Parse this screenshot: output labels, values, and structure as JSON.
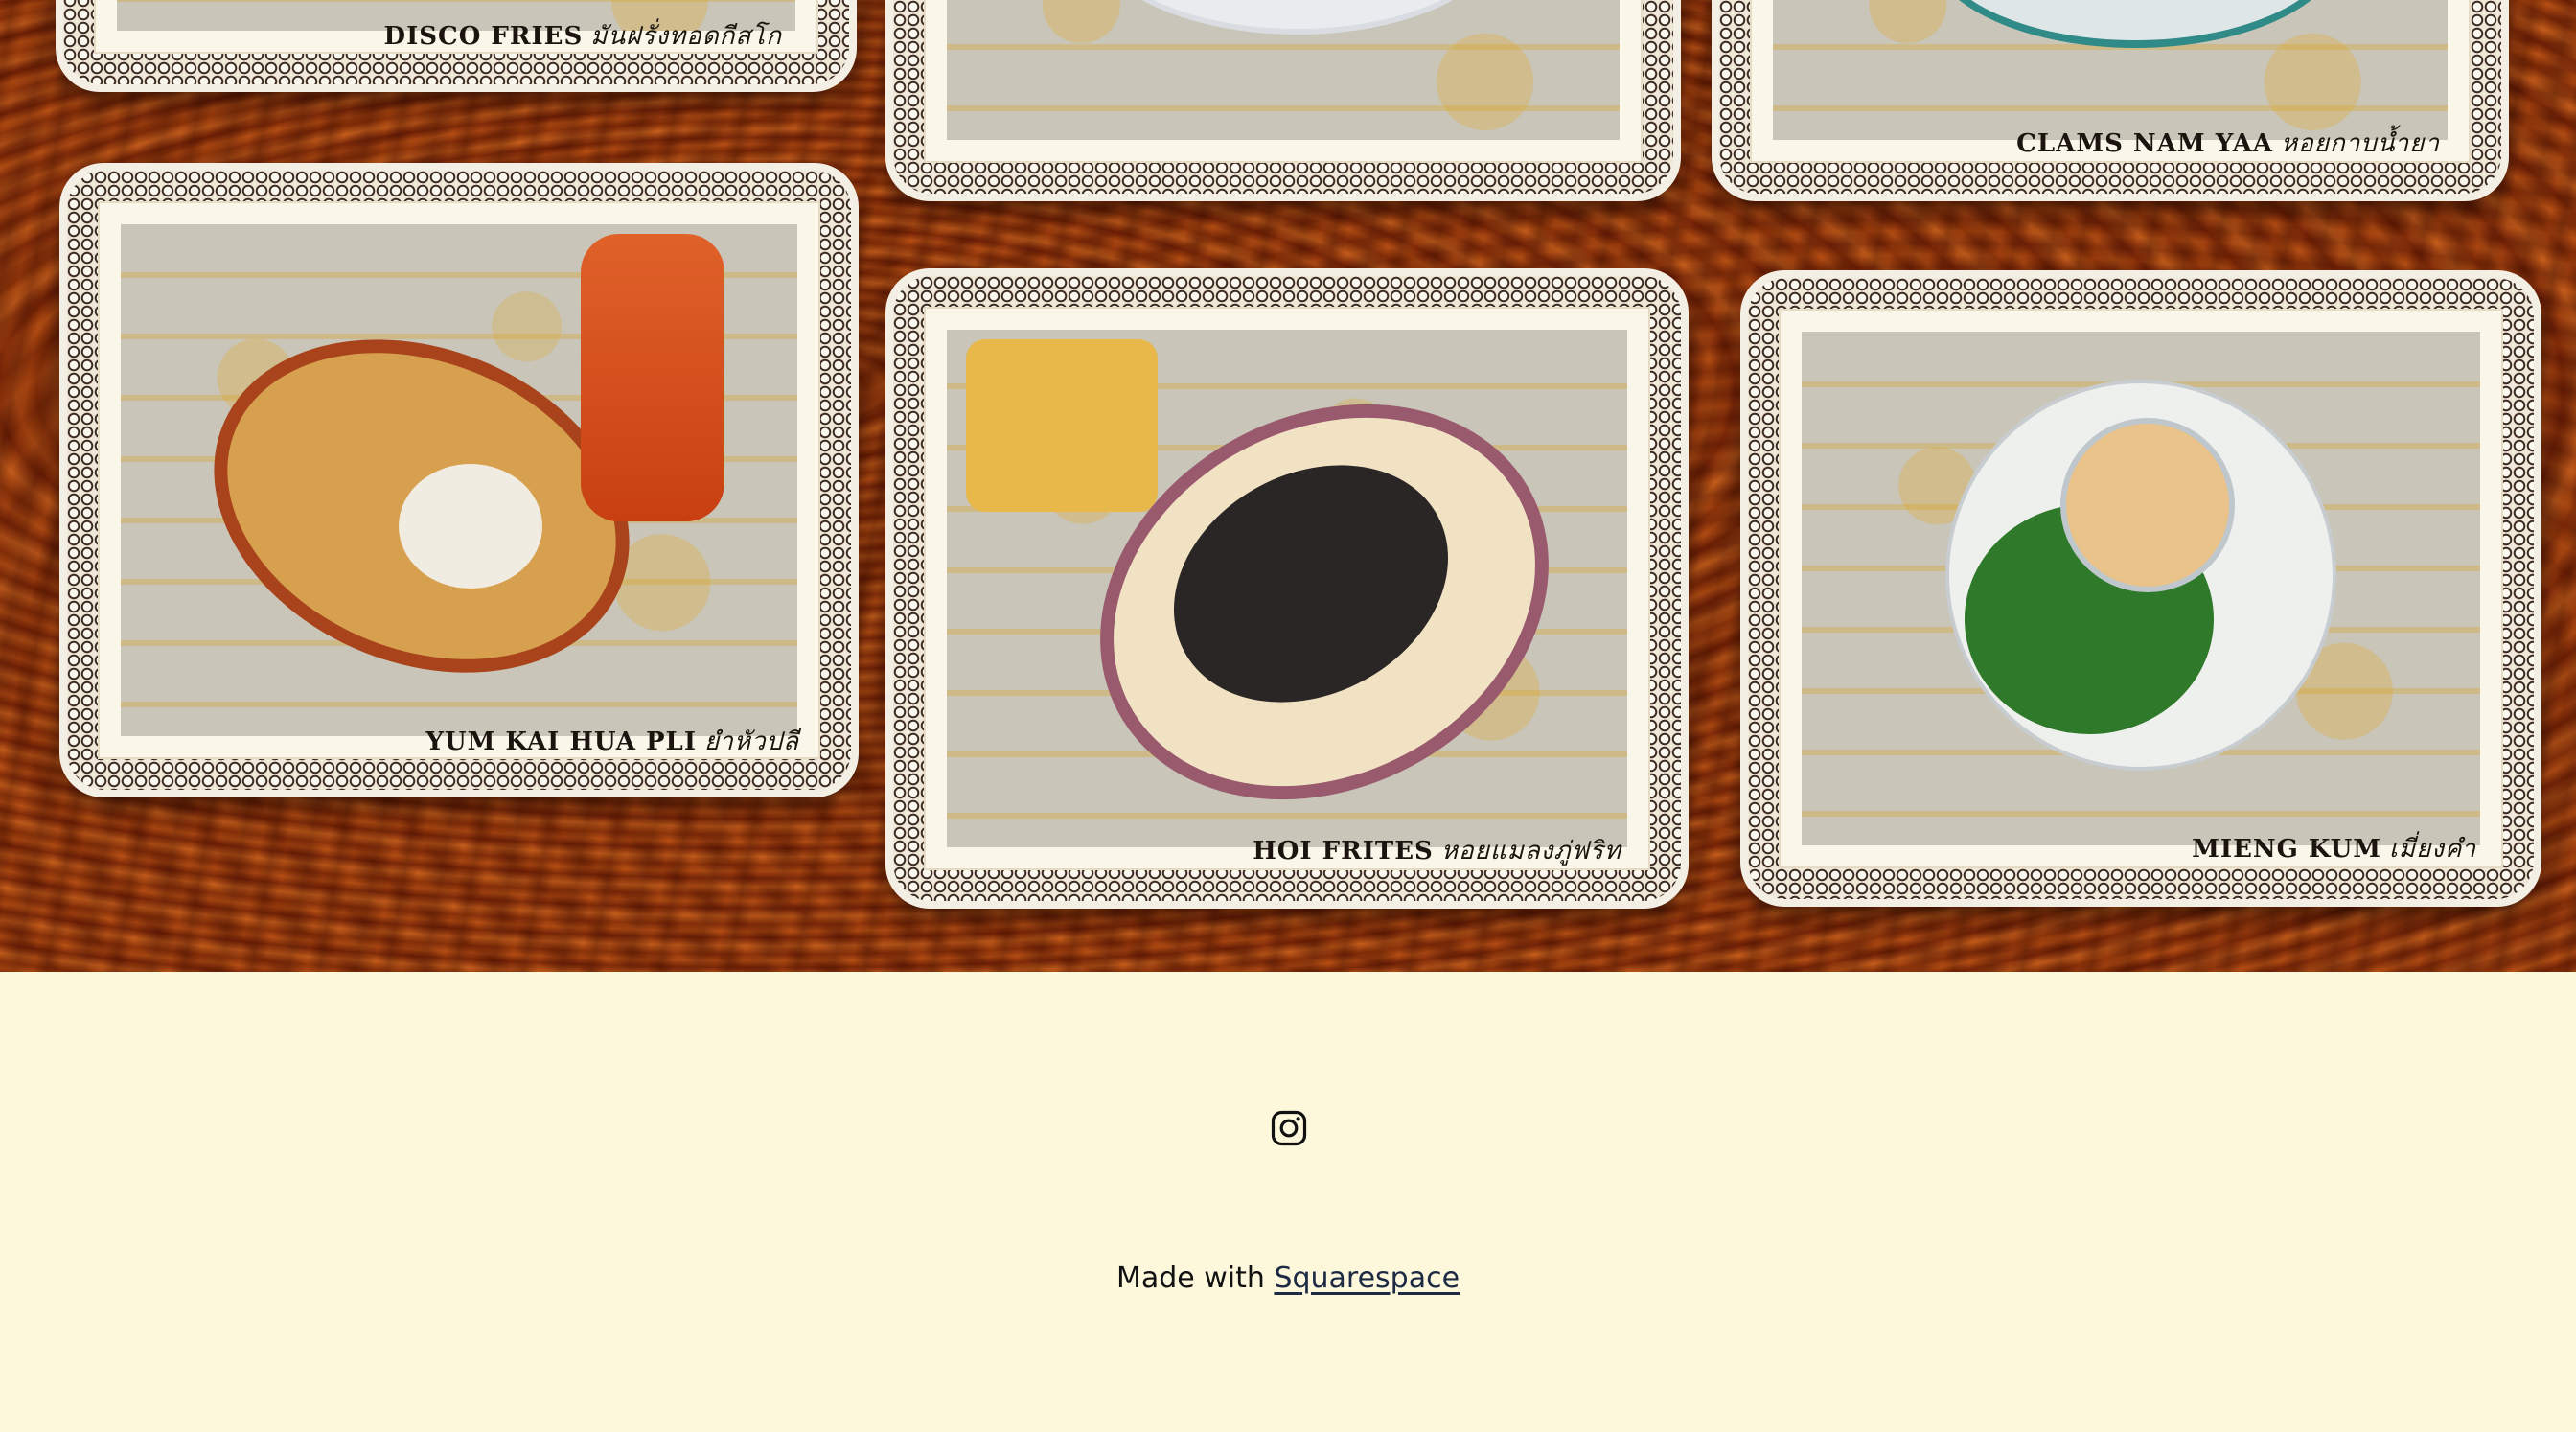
{
  "gallery": {
    "items": [
      {
        "name": "DISCO FRIES",
        "thai": "มันฝรั่งทอดกีสโก"
      },
      {
        "name": "",
        "thai": ""
      },
      {
        "name": "CLAMS NAM YAA",
        "thai": "หอยกาบน้ำยา"
      },
      {
        "name": "YUM KAI HUA PLI",
        "thai": "ยำหัวปลี"
      },
      {
        "name": "HOI FRITES",
        "thai": "หอยแมลงภู่ฟริท"
      },
      {
        "name": "MIENG KUM",
        "thai": "เมี่ยงคำ"
      }
    ]
  },
  "footer": {
    "social_icon": "instagram-icon",
    "credit_prefix": "Made with",
    "credit_link": "Squarespace"
  },
  "colors": {
    "footer_bg": "#fdf7dc",
    "wood": "#8b2d07",
    "link": "#1c2a44"
  }
}
